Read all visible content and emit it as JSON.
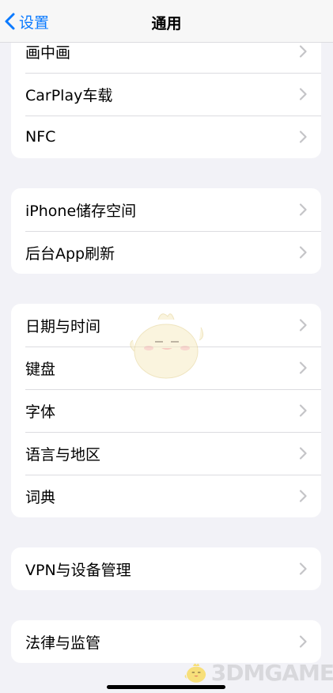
{
  "nav": {
    "back_label": "设置",
    "title": "通用"
  },
  "groups": [
    {
      "items": [
        "画中画",
        "CarPlay车载",
        "NFC"
      ]
    },
    {
      "items": [
        "iPhone储存空间",
        "后台App刷新"
      ]
    },
    {
      "items": [
        "日期与时间",
        "键盘",
        "字体",
        "语言与地区",
        "词典"
      ]
    },
    {
      "items": [
        "VPN与设备管理"
      ]
    },
    {
      "items": [
        "法律与监管"
      ]
    }
  ],
  "watermark": {
    "text": "3DMGAME"
  },
  "colors": {
    "accent": "#0a7aff",
    "background": "#f2f2f7",
    "chevron": "#c4c4c7"
  }
}
